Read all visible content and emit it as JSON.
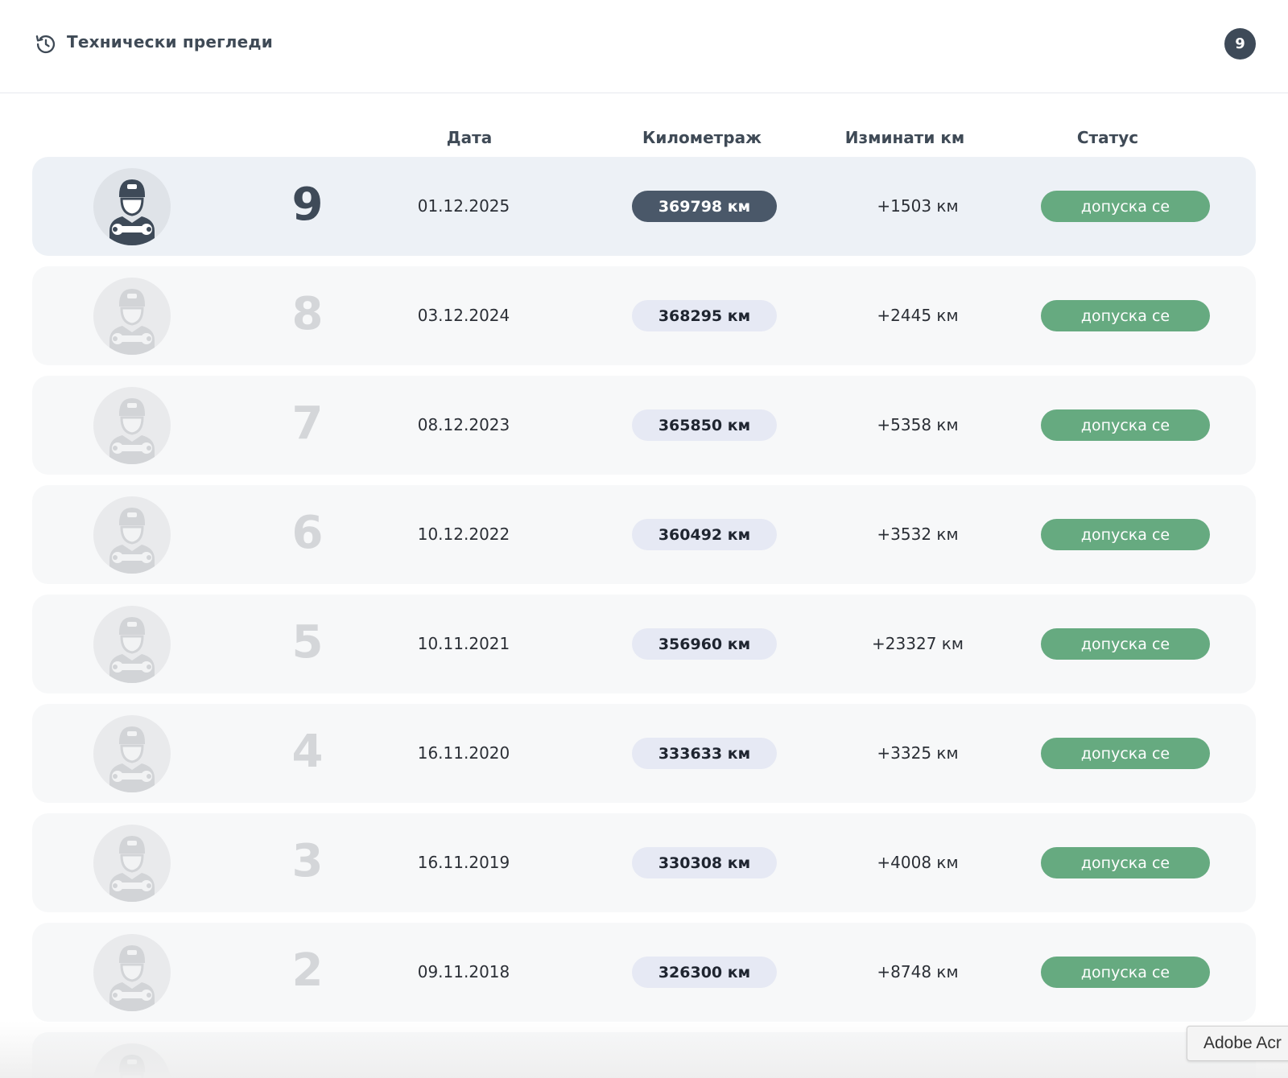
{
  "header": {
    "title": "Технически прегледи",
    "icon": "history-icon",
    "count": "9"
  },
  "columns": {
    "date": "Дата",
    "mileage": "Километраж",
    "delta": "Изминати км",
    "status": "Статус"
  },
  "rows": [
    {
      "index": "9",
      "date": "01.12.2025",
      "mileage": "369798 км",
      "delta": "+1503 км",
      "status": "допуска се",
      "current": true
    },
    {
      "index": "8",
      "date": "03.12.2024",
      "mileage": "368295 км",
      "delta": "+2445 км",
      "status": "допуска се"
    },
    {
      "index": "7",
      "date": "08.12.2023",
      "mileage": "365850 км",
      "delta": "+5358 км",
      "status": "допуска се"
    },
    {
      "index": "6",
      "date": "10.12.2022",
      "mileage": "360492 км",
      "delta": "+3532 км",
      "status": "допуска се"
    },
    {
      "index": "5",
      "date": "10.11.2021",
      "mileage": "356960 км",
      "delta": "+23327 км",
      "status": "допуска се"
    },
    {
      "index": "4",
      "date": "16.11.2020",
      "mileage": "333633 км",
      "delta": "+3325 км",
      "status": "допуска се"
    },
    {
      "index": "3",
      "date": "16.11.2019",
      "mileage": "330308 км",
      "delta": "+4008 км",
      "status": "допуска се"
    },
    {
      "index": "2",
      "date": "09.11.2018",
      "mileage": "326300 км",
      "delta": "+8748 км",
      "status": "допуска се"
    }
  ],
  "tooltip": "Adobe Acr",
  "colors": {
    "status_green": "#66aa80",
    "current_pill": "#4a5869",
    "badge": "#3e4a58"
  }
}
